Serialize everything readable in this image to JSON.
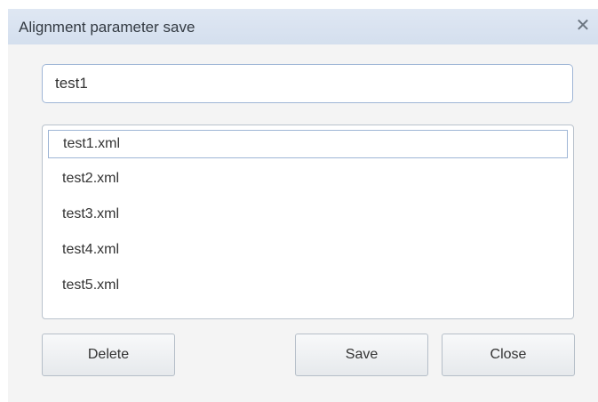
{
  "dialog": {
    "title": "Alignment parameter save",
    "close_icon_glyph": "✕"
  },
  "name_input": {
    "value": "test1"
  },
  "file_list": {
    "items": [
      "test1.xml",
      "test2.xml",
      "test3.xml",
      "test4.xml",
      "test5.xml"
    ],
    "selected_index": 0
  },
  "buttons": {
    "delete_label": "Delete",
    "save_label": "Save",
    "close_label": "Close"
  }
}
